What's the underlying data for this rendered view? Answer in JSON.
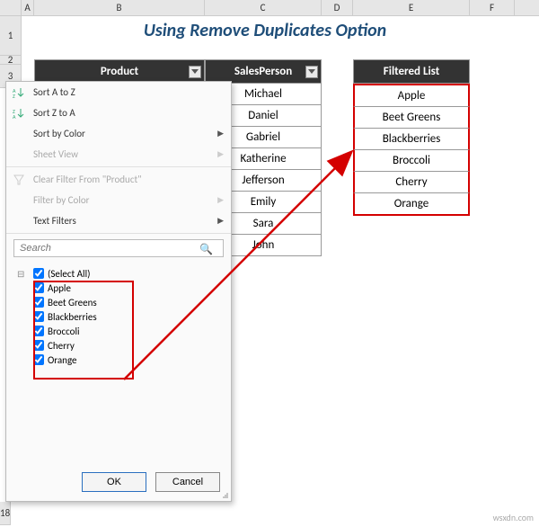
{
  "title": "Using Remove Duplicates Option",
  "columns": [
    "A",
    "B",
    "C",
    "D",
    "E",
    "F"
  ],
  "rows": [
    "1",
    "2",
    "3",
    "18"
  ],
  "headers": {
    "product": "Product",
    "sales": "SalesPerson",
    "filtered": "Filtered List"
  },
  "sales": [
    "Michael",
    "Daniel",
    "Gabriel",
    "Katherine",
    "Jefferson",
    "Emily",
    "Sara",
    "John"
  ],
  "filtered": [
    "Apple",
    "Beet Greens",
    "Blackberries",
    "Broccoli",
    "Cherry",
    "Orange"
  ],
  "menu": {
    "sort_az": "Sort A to Z",
    "sort_za": "Sort Z to A",
    "sort_color": "Sort by Color",
    "sheet_view": "Sheet View",
    "clear_filter": "Clear Filter From \"Product\"",
    "filter_color": "Filter by Color",
    "text_filters": "Text Filters",
    "search_placeholder": "Search",
    "select_all": "(Select All)",
    "items": [
      "Apple",
      "Beet Greens",
      "Blackberries",
      "Broccoli",
      "Cherry",
      "Orange"
    ],
    "ok": "OK",
    "cancel": "Cancel"
  },
  "watermark": "wsxdn.com"
}
